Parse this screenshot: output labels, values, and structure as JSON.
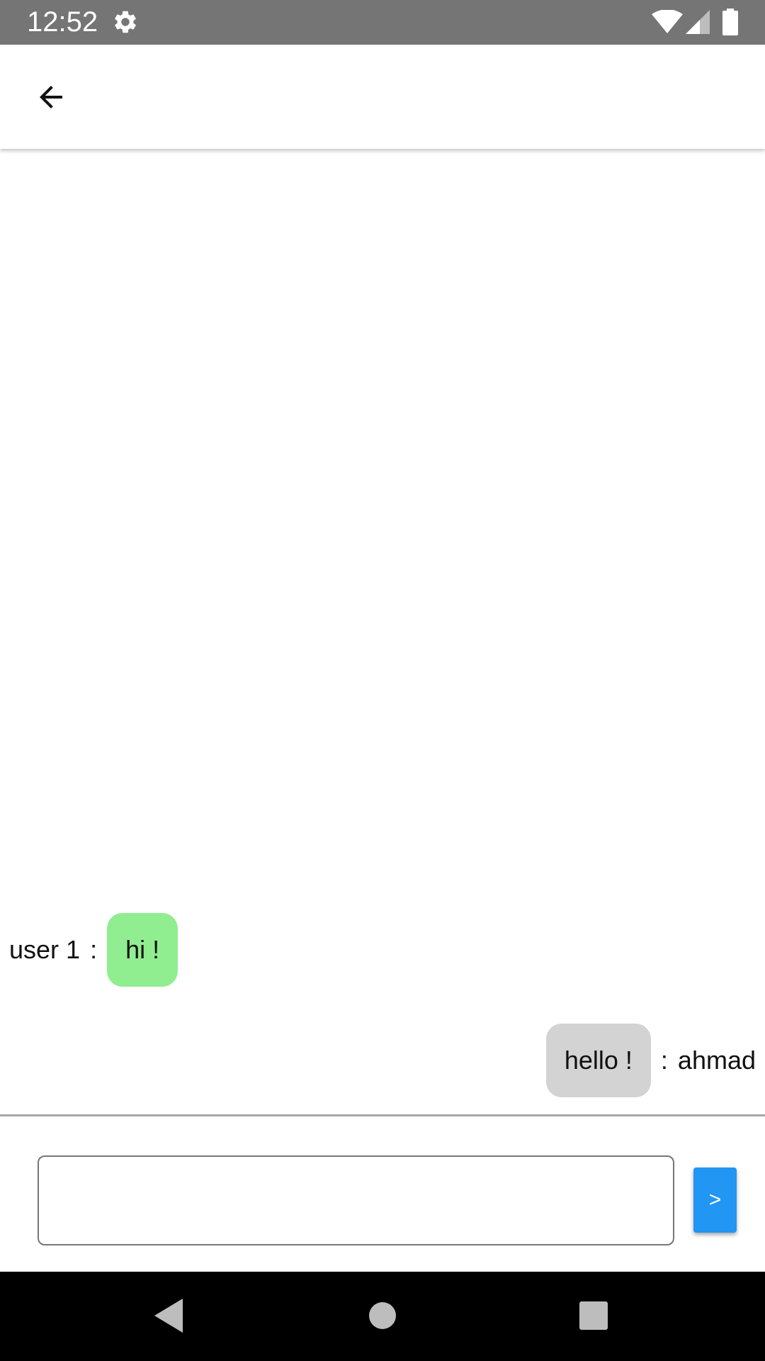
{
  "status_bar": {
    "time": "12:52",
    "icons": [
      "gear-icon",
      "wifi-icon",
      "signal-icon",
      "battery-icon"
    ]
  },
  "app_bar": {
    "back_icon": "arrow-left-icon"
  },
  "messages": [
    {
      "sender": "user 1",
      "separator": ":",
      "text": "hi !",
      "side": "left",
      "bubble_color": "#90ee90"
    },
    {
      "sender": "ahmad",
      "separator": ":",
      "text": "hello !",
      "side": "right",
      "bubble_color": "#d3d3d3"
    }
  ],
  "composer": {
    "input_value": "",
    "placeholder": "",
    "send_label": ">",
    "send_color": "#2196f3"
  },
  "nav_bar": {
    "icons": [
      "nav-back-icon",
      "nav-home-icon",
      "nav-recents-icon"
    ]
  }
}
